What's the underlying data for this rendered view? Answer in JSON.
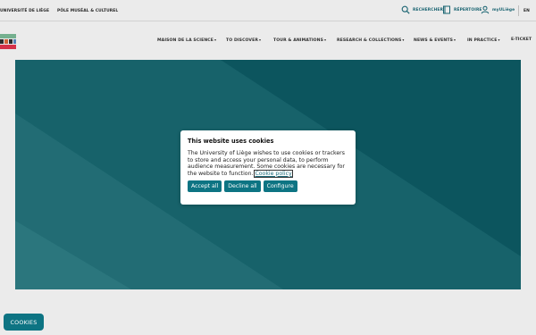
{
  "topbar": {
    "university": "UNIVERSITÉ DE LIÈGE",
    "pole": "PÔLE MUSÉAL & CULTUREL",
    "search_label": "RECHERCHER",
    "repertoire_label": "RÉPERTOIRE",
    "myuliege_label": "myULiège",
    "lang_label": "EN",
    "accent_color": "#1d6d7c"
  },
  "nav": {
    "items": [
      {
        "label": "MAISON DE LA SCIENCE"
      },
      {
        "label": "TO DISCOVER"
      },
      {
        "label": "TOUR & ANIMATIONS"
      },
      {
        "label": "RESEARCH & COLLECTIONS"
      },
      {
        "label": "NEWS & EVENTS"
      },
      {
        "label": "IN PRACTICE"
      },
      {
        "label": "E-TICKET"
      }
    ],
    "caret": "▾"
  },
  "hero": {
    "background_color": "#0e5d67"
  },
  "cookie_modal": {
    "title": "This website uses cookies",
    "body": "The University of Liège wishes to use cookies or trackers to store and access your personal data, to perform audience measurement. Some cookies are necessary for the website to function.",
    "policy_link": "Cookie policy",
    "accept_label": "Accept all",
    "decline_label": "Decline all",
    "configure_label": "Configure",
    "button_color": "#0d7483"
  },
  "cookies_button": {
    "label": "COOKIES"
  }
}
